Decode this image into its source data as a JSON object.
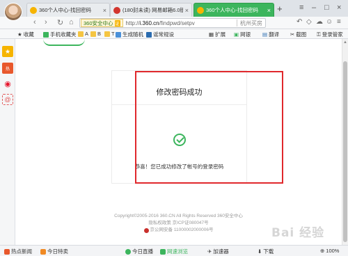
{
  "tabs": [
    {
      "label": "360个人中心-找回密码",
      "active": false
    },
    {
      "label": "(180封未读) 网易邮箱6.0版",
      "active": false
    },
    {
      "label": "360个人中心-找回密码",
      "active": true
    }
  ],
  "address": {
    "site_badge": "360安全中心",
    "cert": "证",
    "url_prefix": "http://",
    "url_domain": "i.360.cn",
    "url_path": "/findpwd/setpv",
    "search_hint": "杭州买房"
  },
  "bookmarks": {
    "left": [
      "收藏",
      "手机收藏夹",
      "A",
      "B",
      "T",
      "生成随机",
      "谣常规设"
    ],
    "right": [
      "扩展",
      "网银",
      "翻译",
      "截图",
      "登录管家"
    ]
  },
  "card": {
    "title": "修改密码成功",
    "message": "恭喜！您已成功修改了帐号的登录密码"
  },
  "footer": {
    "copyright": "Copyright©2005-2016 360.CN All Rights Reserved 360安全中心",
    "icp": "隐私权政策 京ICP证080047号",
    "police": "京公网安备 11000002000006号"
  },
  "status": {
    "left": [
      "热点新闻",
      "今日特卖"
    ],
    "right": [
      "今日直播",
      "加速器",
      "下载",
      "100%"
    ],
    "browse_mode": "网速浏览"
  },
  "watermark": "Bai 经验",
  "colors": {
    "accent": "#3cb55d",
    "highlight": "#e0282c"
  }
}
